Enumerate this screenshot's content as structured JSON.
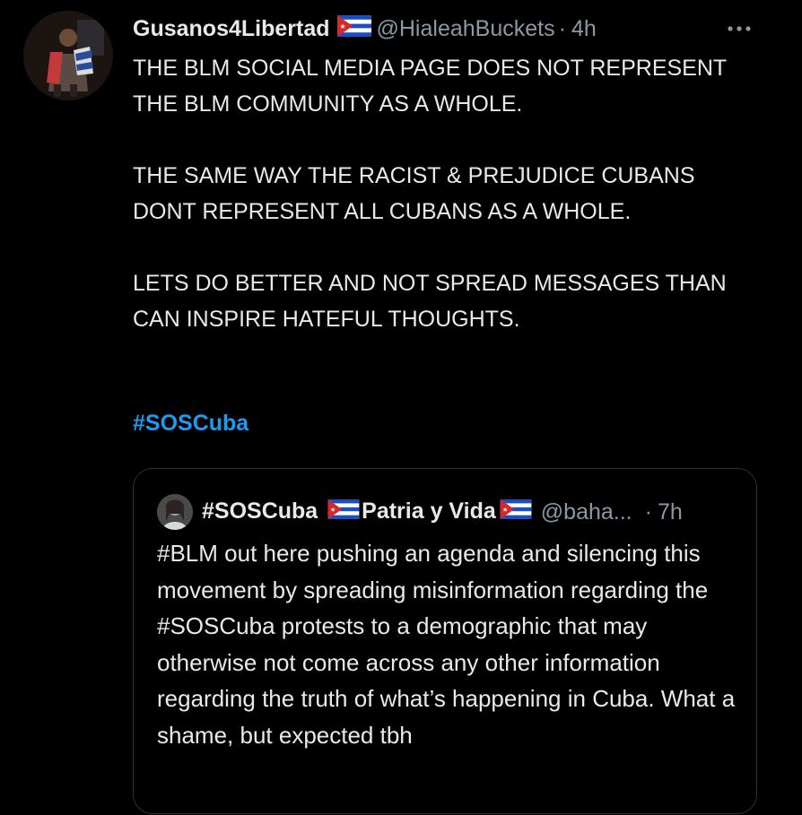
{
  "tweet": {
    "display_name": "Gusanos4Libertad",
    "handle": "@HialeahBuckets",
    "separator": "·",
    "time": "4h",
    "paragraphs": [
      "THE BLM SOCIAL MEDIA PAGE DOES NOT REPRESENT THE BLM COMMUNITY AS A WHOLE.",
      "THE SAME WAY THE RACIST & PREJUDICE CUBANS DONT REPRESENT ALL CUBANS AS A WHOLE.",
      "LETS DO BETTER AND NOT SPREAD MESSAGES THAN CAN INSPIRE HATEFUL THOUGHTS."
    ],
    "hashtag": "#SOSCuba",
    "more_icon": "more-horizontal-icon"
  },
  "quote": {
    "name_part1": "#SOSCuba",
    "name_part2": "Patria y Vida",
    "handle": "@baha...",
    "separator": "·",
    "time": "7h",
    "text": "#BLM out here pushing an agenda and silencing this movement by spreading misinformation regarding the #SOSCuba protests to a demographic that may otherwise not come across any other information regarding the truth of what’s happening in Cuba. What a shame, but expected tbh"
  },
  "colors": {
    "background": "#000000",
    "text": "#e7e9ea",
    "secondary": "#8b98a5",
    "link": "#1d9bf0",
    "border": "#2f3336"
  }
}
